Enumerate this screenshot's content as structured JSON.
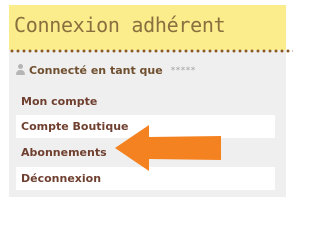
{
  "header": {
    "title": "Connexion adhérent"
  },
  "status": {
    "icon": "user-icon",
    "label": "Connecté en tant que",
    "username_masked": "*****"
  },
  "menu": {
    "items": [
      {
        "label": "Mon compte"
      },
      {
        "label": "Compte Boutique"
      },
      {
        "label": "Abonnements"
      },
      {
        "label": "Déconnexion"
      }
    ]
  },
  "colors": {
    "header_bg": "#fbec8c",
    "panel_bg": "#efefef",
    "dots": "#8a5a1e",
    "menu_text": "#6f3f2f",
    "arrow": "#f58220"
  }
}
